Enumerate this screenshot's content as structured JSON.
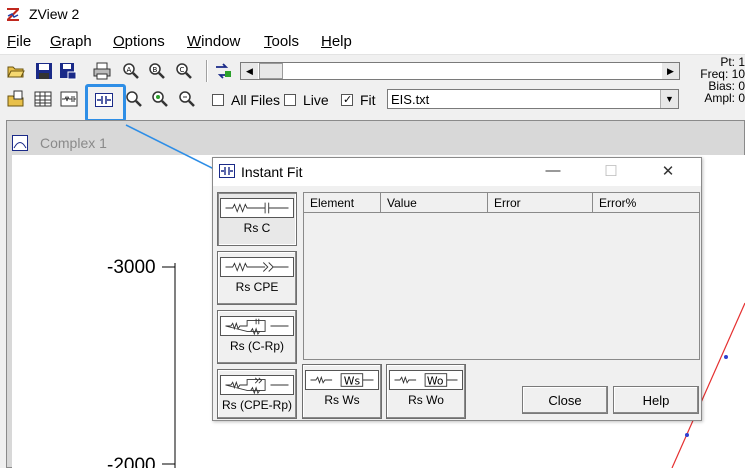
{
  "app": {
    "title": "ZView 2",
    "logo_icon": "zview-logo-icon"
  },
  "menu": [
    {
      "label": "File",
      "key": "F",
      "rest": "ile"
    },
    {
      "label": "Graph",
      "key": "G",
      "rest": "raph"
    },
    {
      "label": "Options",
      "key": "O",
      "rest": "ptions"
    },
    {
      "label": "Window",
      "key": "W",
      "rest": "indow"
    },
    {
      "label": "Tools",
      "key": "T",
      "rest": "ools"
    },
    {
      "label": "Help",
      "key": "H",
      "rest": "elp"
    }
  ],
  "toolbar": {
    "all_files_label": "All Files",
    "all_files_checked": false,
    "live_label": "Live",
    "live_checked": false,
    "fit_label": "Fit",
    "fit_checked": true,
    "file_select_value": "EIS.txt",
    "status": {
      "pt": "Pt: 1",
      "freq": "Freq: 10",
      "bias": "Bias: 0",
      "ampl": "Ampl: 0"
    }
  },
  "graph": {
    "window_title": "Complex 1",
    "y_tick_top": "-3000",
    "y_tick_bottom": "-2000",
    "accent_line_color": "#e53030",
    "point_color": "#3040d0"
  },
  "dialog": {
    "title": "Instant Fit",
    "controls": {
      "minimize": "—",
      "maximize": "☐",
      "close": "✕"
    },
    "circuits": [
      {
        "label": "Rs C",
        "selected": true
      },
      {
        "label": "Rs CPE",
        "selected": false
      },
      {
        "label": "Rs (C-Rp)",
        "selected": false
      },
      {
        "label": "Rs (CPE-Rp)",
        "selected": false
      },
      {
        "label": "Rs Ws",
        "selected": false,
        "element_text": "Ws"
      },
      {
        "label": "Rs Wo",
        "selected": false,
        "element_text": "Wo"
      }
    ],
    "table_headers": [
      "Element",
      "Value",
      "Error",
      "Error%"
    ],
    "close_label": "Close",
    "help_label": "Help"
  },
  "annotation": {
    "highlight_color": "#2e8ee6"
  }
}
